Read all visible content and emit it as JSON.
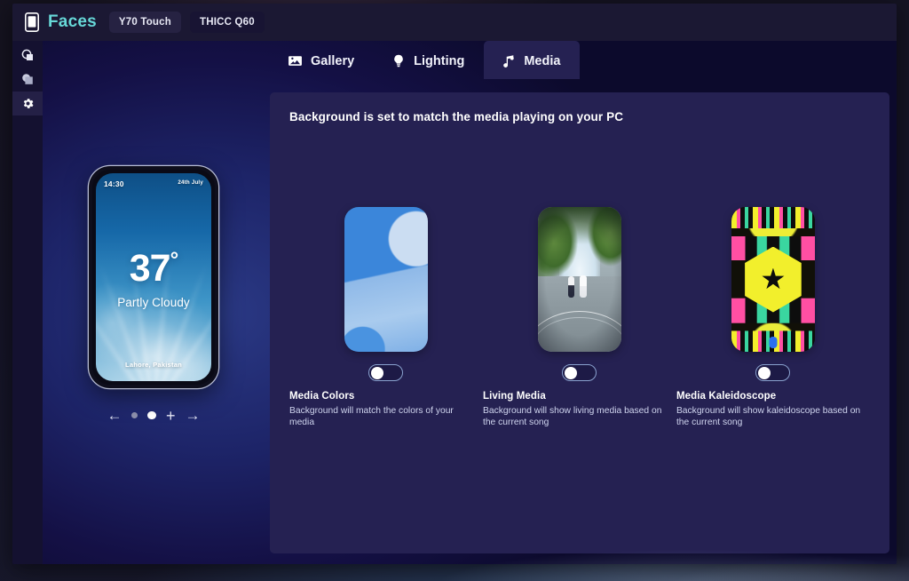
{
  "app": {
    "title": "Faces",
    "logo_icon": "phone-icon",
    "devices": [
      {
        "label": "Y70 Touch",
        "active": false
      },
      {
        "label": "THICC Q60",
        "active": true
      }
    ]
  },
  "sidebar": {
    "items": [
      {
        "icon": "shape-circle-square-icon",
        "selected": false
      },
      {
        "icon": "shape-circle-square-filled-icon",
        "selected": false
      },
      {
        "icon": "gear-icon",
        "selected": true
      }
    ]
  },
  "tabs": [
    {
      "label": "Gallery",
      "icon": "image-icon",
      "active": false
    },
    {
      "label": "Lighting",
      "icon": "bulb-icon",
      "active": false
    },
    {
      "label": "Media",
      "icon": "music-note-icon",
      "active": true
    }
  ],
  "panel": {
    "heading": "Background is set to match the media playing on your PC",
    "cards": [
      {
        "title": "Media Colors",
        "description": "Background will match the colors of your media",
        "toggle_on": false,
        "thumb": "media-colors-thumb"
      },
      {
        "title": "Living Media",
        "description": "Background will show living media based on the current song",
        "toggle_on": false,
        "thumb": "living-media-thumb"
      },
      {
        "title": "Media Kaleidoscope",
        "description": "Background will show kaleidoscope based on the current song",
        "toggle_on": false,
        "thumb": "media-kaleidoscope-thumb"
      }
    ]
  },
  "preview": {
    "time": "14:30",
    "date": "24th July",
    "temperature": "37",
    "degree_symbol": "°",
    "condition": "Partly Cloudy",
    "location": "Lahore, Pakistan",
    "pager": {
      "prev_icon": "arrow-left-icon",
      "next_icon": "arrow-right-icon",
      "add_icon": "plus-icon",
      "dots": [
        {
          "active": false
        },
        {
          "active": true
        }
      ]
    }
  },
  "colors": {
    "accent": "#67d8d8",
    "panel": "#252152",
    "window": "#0b0a2a",
    "titlebar": "#1b1833",
    "toggle_border": "#8aa2cf"
  }
}
